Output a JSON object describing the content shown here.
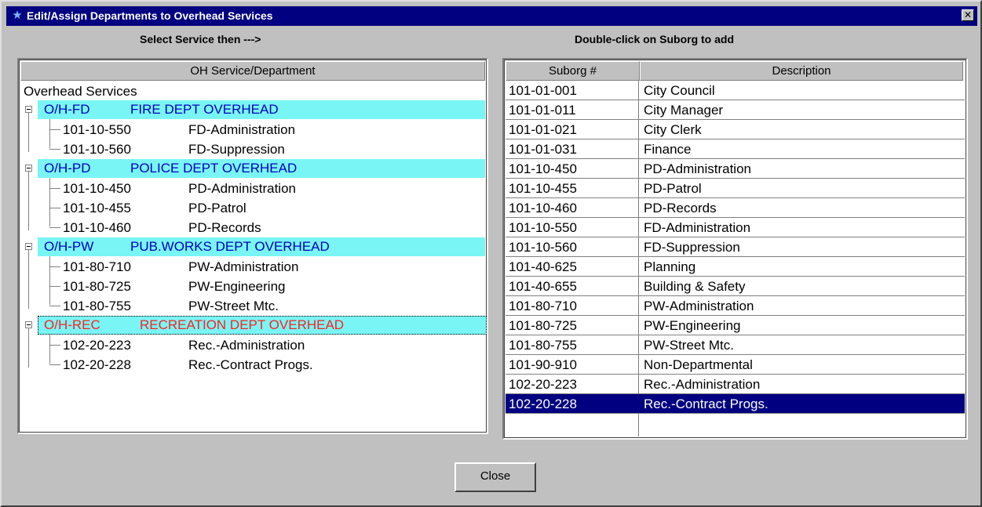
{
  "window": {
    "title": "Edit/Assign Departments to Overhead Services"
  },
  "left": {
    "caption": "Select Service then  --->",
    "column_header": "OH Service/Department",
    "root_label": "Overhead Services",
    "groups": [
      {
        "code": "O/H-FD",
        "name": "FIRE DEPT OVERHEAD",
        "selected": false,
        "children": [
          {
            "suborg": "101-10-550",
            "desc": "FD-Administration"
          },
          {
            "suborg": "101-10-560",
            "desc": "FD-Suppression"
          }
        ]
      },
      {
        "code": "O/H-PD",
        "name": "POLICE DEPT OVERHEAD",
        "selected": false,
        "children": [
          {
            "suborg": "101-10-450",
            "desc": "PD-Administration"
          },
          {
            "suborg": "101-10-455",
            "desc": "PD-Patrol"
          },
          {
            "suborg": "101-10-460",
            "desc": "PD-Records"
          }
        ]
      },
      {
        "code": "O/H-PW",
        "name": "PUB.WORKS DEPT OVERHEAD",
        "selected": false,
        "children": [
          {
            "suborg": "101-80-710",
            "desc": "PW-Administration"
          },
          {
            "suborg": "101-80-725",
            "desc": "PW-Engineering"
          },
          {
            "suborg": "101-80-755",
            "desc": "PW-Street Mtc."
          }
        ]
      },
      {
        "code": "O/H-REC",
        "name": "RECREATION DEPT OVERHEAD",
        "selected": true,
        "children": [
          {
            "suborg": "102-20-223",
            "desc": "Rec.-Administration"
          },
          {
            "suborg": "102-20-228",
            "desc": "Rec.-Contract Progs."
          }
        ]
      }
    ]
  },
  "right": {
    "caption": "Double-click on Suborg to add",
    "headers": {
      "suborg": "Suborg #",
      "description": "Description"
    },
    "rows": [
      {
        "suborg": "101-01-001",
        "description": "City Council"
      },
      {
        "suborg": "101-01-011",
        "description": "City Manager"
      },
      {
        "suborg": "101-01-021",
        "description": "City Clerk"
      },
      {
        "suborg": "101-01-031",
        "description": "Finance"
      },
      {
        "suborg": "101-10-450",
        "description": "PD-Administration"
      },
      {
        "suborg": "101-10-455",
        "description": "PD-Patrol"
      },
      {
        "suborg": "101-10-460",
        "description": "PD-Records"
      },
      {
        "suborg": "101-10-550",
        "description": "FD-Administration"
      },
      {
        "suborg": "101-10-560",
        "description": "FD-Suppression"
      },
      {
        "suborg": "101-40-625",
        "description": "Planning"
      },
      {
        "suborg": "101-40-655",
        "description": "Building & Safety"
      },
      {
        "suborg": "101-80-710",
        "description": "PW-Administration"
      },
      {
        "suborg": "101-80-725",
        "description": "PW-Engineering"
      },
      {
        "suborg": "101-80-755",
        "description": "PW-Street Mtc."
      },
      {
        "suborg": "101-90-910",
        "description": "Non-Departmental"
      },
      {
        "suborg": "102-20-223",
        "description": "Rec.-Administration"
      },
      {
        "suborg": "102-20-228",
        "description": "Rec.-Contract Progs.",
        "highlighted": true
      }
    ]
  },
  "buttons": {
    "close": "Close"
  },
  "colors": {
    "titlebar": "#000080",
    "group_band": "#7af5f5",
    "group_text": "#0000c0",
    "selected_group_text": "#ff2020",
    "row_highlight": "#000080"
  },
  "icons": {
    "app": "star-icon",
    "close": "close-icon",
    "expander": "minus-box-icon"
  }
}
